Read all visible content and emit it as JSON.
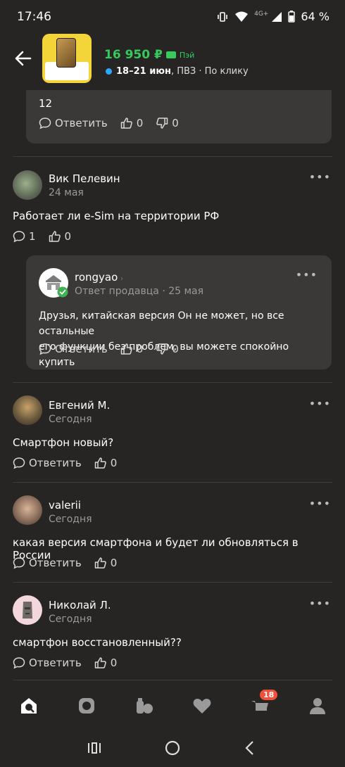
{
  "status": {
    "time": "17:46",
    "network": "4G+",
    "battery": "64 %"
  },
  "header": {
    "price": "16 950 ₽",
    "pay_label": "Пэй",
    "delivery_dates": "18–21 июн",
    "delivery_rest": ", ПВЗ · По клику"
  },
  "prev_reply": {
    "text": "12",
    "reply_label": "Ответить",
    "likes": "0",
    "dislikes": "0"
  },
  "reviews": [
    {
      "author": "Вик Пелевин",
      "date": "24 мая",
      "text": "Работает ли e-Sim на территории РФ",
      "comments": "1",
      "likes": "0",
      "reply": {
        "author": "rongyao",
        "role": "Ответ продавца",
        "date": "25 мая",
        "text_line1": "Друзья, китайская версия Он не может, но все остальные",
        "text_line2": "его функции без проблем, вы можете спокойно купить",
        "reply_label": "Ответить",
        "likes": "0",
        "dislikes": "0"
      }
    },
    {
      "author": "Евгений М.",
      "date": "Сегодня",
      "text": "Смартфон новый?",
      "reply_label": "Ответить",
      "likes": "0"
    },
    {
      "author": "valerii",
      "date": "Сегодня",
      "text": "какая версия смартфона и будет ли обновляться в России",
      "reply_label": "Ответить",
      "likes": "0"
    },
    {
      "author": "Николай Л.",
      "date": "Сегодня",
      "text": "смартфон восстановленный??",
      "reply_label": "Ответить",
      "likes": "0"
    }
  ],
  "bottom_nav": {
    "items": [
      "home-icon",
      "catalog-icon",
      "products-icon",
      "favorites-icon",
      "cart-icon",
      "profile-icon"
    ],
    "cart_badge": "18"
  },
  "colors": {
    "background": "#262524",
    "card": "#3a3938",
    "price": "#37c95c",
    "badge": "#f2503a",
    "delivery_dot": "#2ea7ff"
  }
}
